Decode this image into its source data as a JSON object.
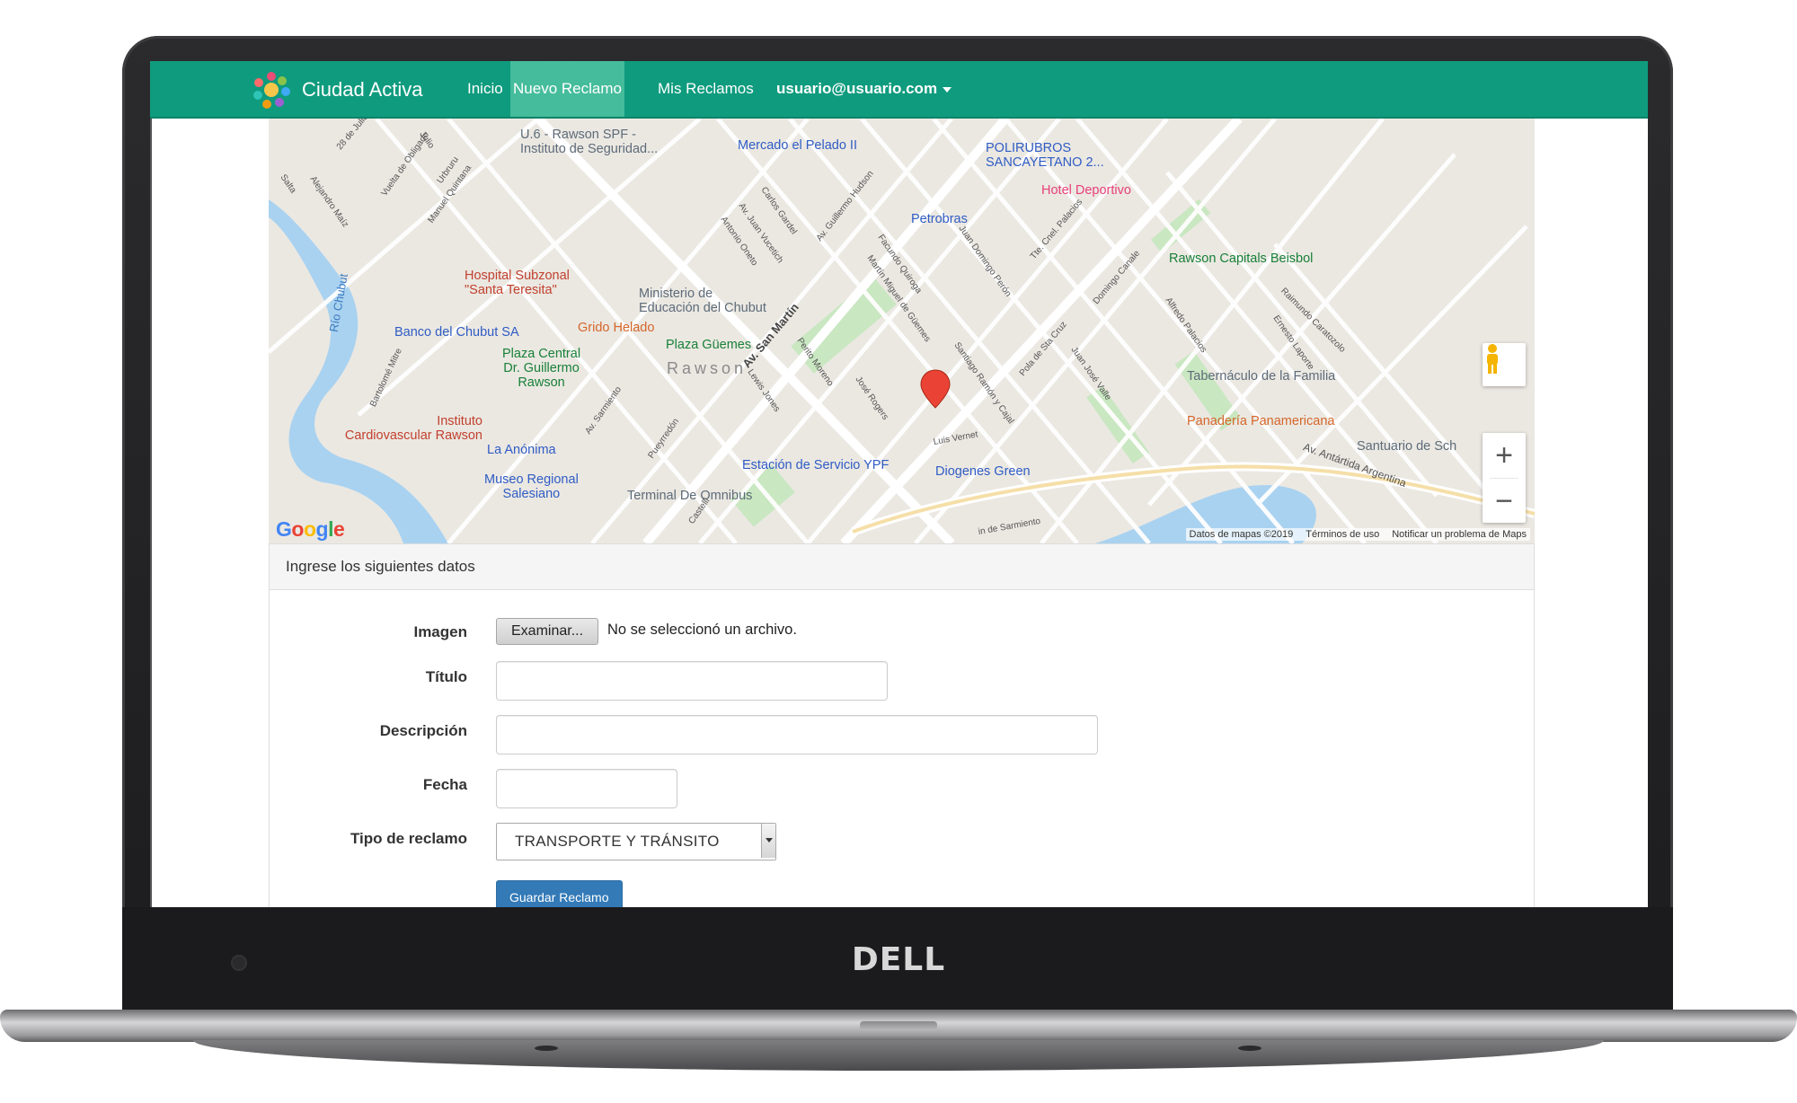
{
  "nav": {
    "brand": "Ciudad Activa",
    "items": [
      {
        "label": "Inicio",
        "active": false
      },
      {
        "label": "Nuevo Reclamo",
        "active": true
      },
      {
        "label": "Mis Reclamos",
        "active": false
      }
    ],
    "user": "usuario@usuario.com"
  },
  "map": {
    "logo": "Google",
    "city": "Rawson",
    "attribution": [
      "Datos de mapas ©2019",
      "Términos de uso",
      "Notificar un problema de Maps"
    ],
    "zoom_in": "+",
    "zoom_out": "−",
    "pois": {
      "u6": "U.6 - Rawson SPF -\nInstituto de Seguridad...",
      "mercado": "Mercado el Pelado II",
      "polirubros": "POLIRUBROS\nSANCAYETANO 2...",
      "hotel": "Hotel Deportivo",
      "petrobras": "Petrobras",
      "hospital": "Hospital Subzonal\n\"Santa Teresita\"",
      "ministerio": "Ministerio de\nEducación del Chubut",
      "rawson_capitals": "Rawson Capitals Beisbol",
      "banco": "Banco del Chubut SA",
      "grido": "Grido Helado",
      "plaza_guemes": "Plaza Güemes",
      "plaza_central": "Plaza Central\nDr. Guillermo\nRawson",
      "tabernaculo": "Tabernáculo de la Familia",
      "instituto": "Instituto\nCardiovascular Rawson",
      "panaderia": "Panadería Panamericana",
      "santuario": "Santuario de Sch",
      "la_anonima": "La Anónima",
      "estacion": "Estación de Servicio YPF",
      "diogenes": "Diogenes Green",
      "museo": "Museo Regional\nSalesiano",
      "terminal": "Terminal De Omnibus"
    },
    "streets": {
      "julio": "Julio",
      "veinticinco": "28 de Julio",
      "salta": "Salta",
      "alejandro": "Alejandro Maíz",
      "vuelta": "Vuelta de Obligado",
      "urbruru": "Urbruru",
      "manuel_quintana": "Manuel Quintana",
      "carlos_gardel": "Carlos Gardel",
      "juan_vucetich": "Av. Juan Vucetich",
      "antonio_oneto": "Antonio Oneto",
      "guillermo_hudson": "Av. Guillermo Hudson",
      "facundo": "Facundo Quiroga",
      "martin_guemes": "Martín Miguel de Güemes",
      "juan_domingo": "Juan Domingo Perón",
      "tte_palacios": "Tte. Cnel. Palacios",
      "domingo_canale": "Domingo Canale",
      "av_san_martin": "Av. San Martín",
      "perito_moreno": "Perito Moreno",
      "lewis_jones": "Lewis Jones",
      "jose_rogers": "José Rogers",
      "santiago_cajal": "Santiago Ramón y Cajal",
      "pola_cruz": "Pola de Sta Cruz",
      "juan_jose_valle": "Juan José Valle",
      "alfredo": "Alfredo Palacios",
      "ernesto": "Ernesto Laporte",
      "raimundo": "Raimundo Caratozolo",
      "rio_chubut": "Río Chubut",
      "bartolome": "Bartolomé Mitre",
      "av_sarmiento": "Av. Sarmiento",
      "pueyrredon": "Pueyrredón",
      "luis_vernet": "Luis Vernet",
      "av_antartida": "Av. Antártida Argentina",
      "castelli": "Castelli",
      "sarmiento2": "in de Sarmiento"
    }
  },
  "form": {
    "heading": "Ingrese los siguientes datos",
    "imagen_label": "Imagen",
    "file_button": "Examinar...",
    "file_status": "No se seleccionó un archivo.",
    "titulo_label": "Título",
    "titulo_value": "",
    "descripcion_label": "Descripción",
    "descripcion_value": "",
    "fecha_label": "Fecha",
    "fecha_value": "",
    "tipo_label": "Tipo de reclamo",
    "tipo_value": "TRANSPORTE Y TRÁNSITO",
    "submit": "Guardar Reclamo"
  },
  "device": {
    "brand": "DELL"
  },
  "colors": {
    "navbar": "#0f9b7e",
    "nav_active": "#45bc9b",
    "primary_button": "#337ab7"
  }
}
